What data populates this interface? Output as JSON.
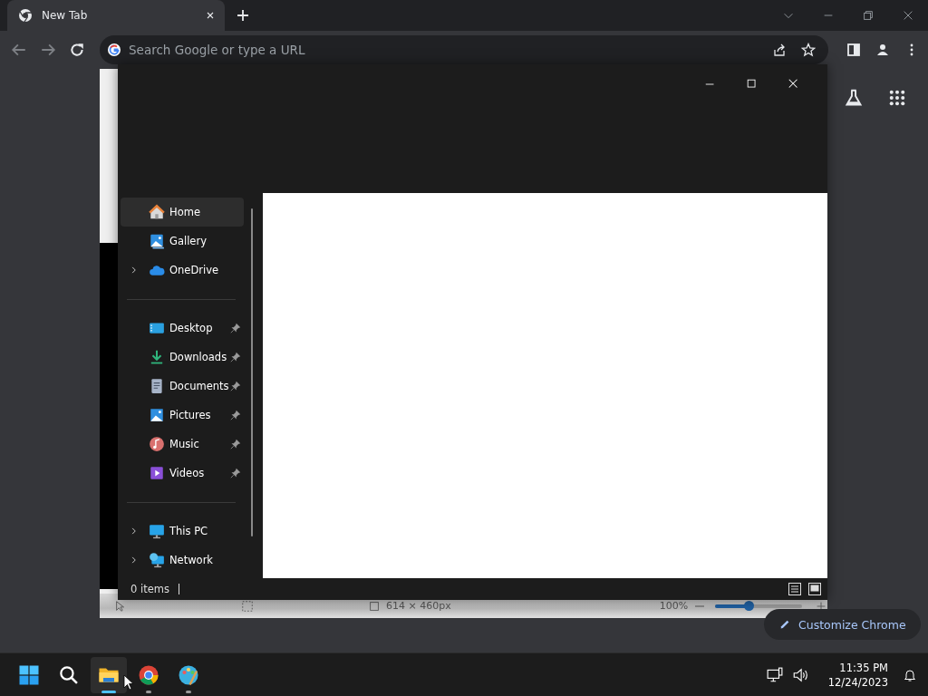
{
  "browser": {
    "tabs": [
      {
        "title": "New Tab",
        "selected": true
      }
    ],
    "omnibox": {
      "placeholder": "Search Google or type a URL"
    },
    "customize_button": "Customize Chrome"
  },
  "paint": {
    "status_bar": {
      "canvas_size": "614 × 460px",
      "zoom": "100%",
      "zoom_slider": {
        "level": 0.38
      }
    }
  },
  "explorer": {
    "sidebar": {
      "sections": [
        {
          "items": [
            {
              "label": "Home",
              "selected": true,
              "expandable": false,
              "pinned": false
            },
            {
              "label": "Gallery",
              "selected": false,
              "expandable": false,
              "pinned": false
            },
            {
              "label": "OneDrive",
              "selected": false,
              "expandable": true,
              "pinned": false
            }
          ]
        },
        {
          "items": [
            {
              "label": "Desktop",
              "selected": false,
              "expandable": false,
              "pinned": true
            },
            {
              "label": "Downloads",
              "selected": false,
              "expandable": false,
              "pinned": true
            },
            {
              "label": "Documents",
              "selected": false,
              "expandable": false,
              "pinned": true
            },
            {
              "label": "Pictures",
              "selected": false,
              "expandable": false,
              "pinned": true
            },
            {
              "label": "Music",
              "selected": false,
              "expandable": false,
              "pinned": true
            },
            {
              "label": "Videos",
              "selected": false,
              "expandable": false,
              "pinned": true
            }
          ]
        },
        {
          "items": [
            {
              "label": "This PC",
              "selected": false,
              "expandable": true,
              "pinned": false
            },
            {
              "label": "Network",
              "selected": false,
              "expandable": true,
              "pinned": false
            }
          ]
        }
      ]
    },
    "status_bar": {
      "item_count": "0 items"
    }
  },
  "taskbar": {
    "apps": [
      {
        "selected": true,
        "running": true
      },
      {
        "selected": false,
        "running": true
      },
      {
        "selected": false,
        "running": true
      }
    ],
    "clock": {
      "time": "11:35 PM",
      "date": "12/24/2023"
    }
  }
}
